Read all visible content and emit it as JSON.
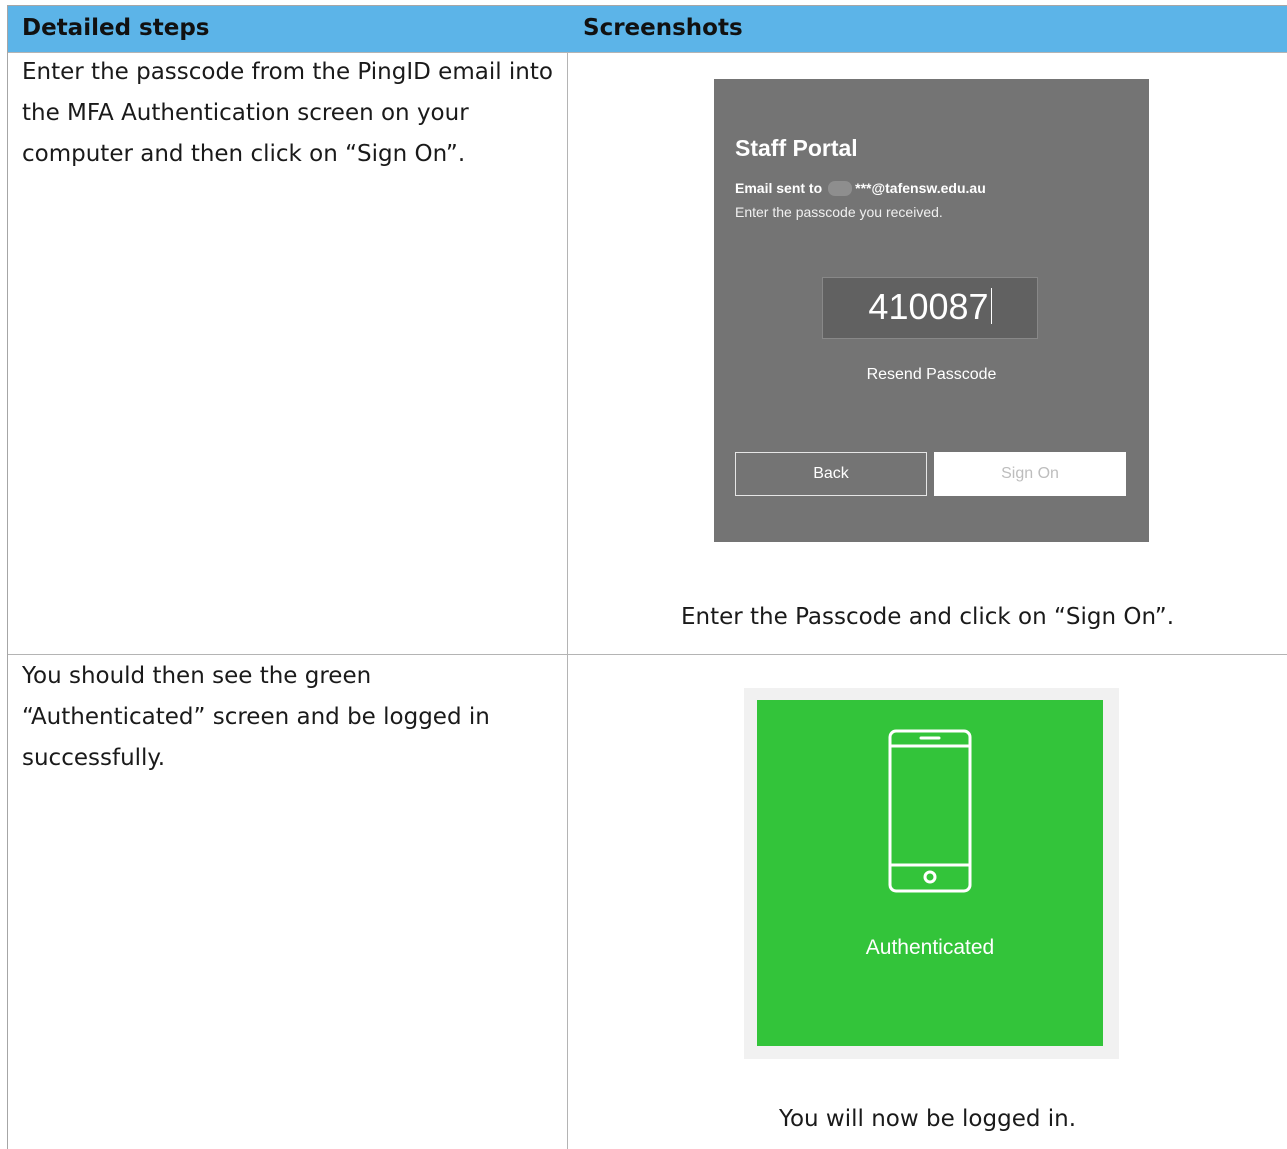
{
  "table": {
    "headers": [
      "Detailed steps",
      "Screenshots"
    ],
    "rows": [
      {
        "step": "Enter the passcode from the PingID email into the MFA Authentication screen on your computer and then click on “Sign On”.",
        "caption": "Enter the Passcode and click on “Sign On”."
      },
      {
        "step": "You should then see the green “Authenticated” screen and be logged in successfully.",
        "caption": "You will now be logged in."
      }
    ]
  },
  "portal": {
    "title": "Staff Portal",
    "email_prefix": "Email sent to",
    "email_masked": "***@tafensw.edu.au",
    "instruction": "Enter the passcode you received.",
    "passcode": "410087",
    "resend": "Resend Passcode",
    "back": "Back",
    "sign_on": "Sign On"
  },
  "auth": {
    "label": "Authenticated",
    "icon": "phone-icon",
    "color": "#33c43a"
  },
  "colors": {
    "header": "#5cb4e8",
    "portal_bg": "#747474"
  }
}
